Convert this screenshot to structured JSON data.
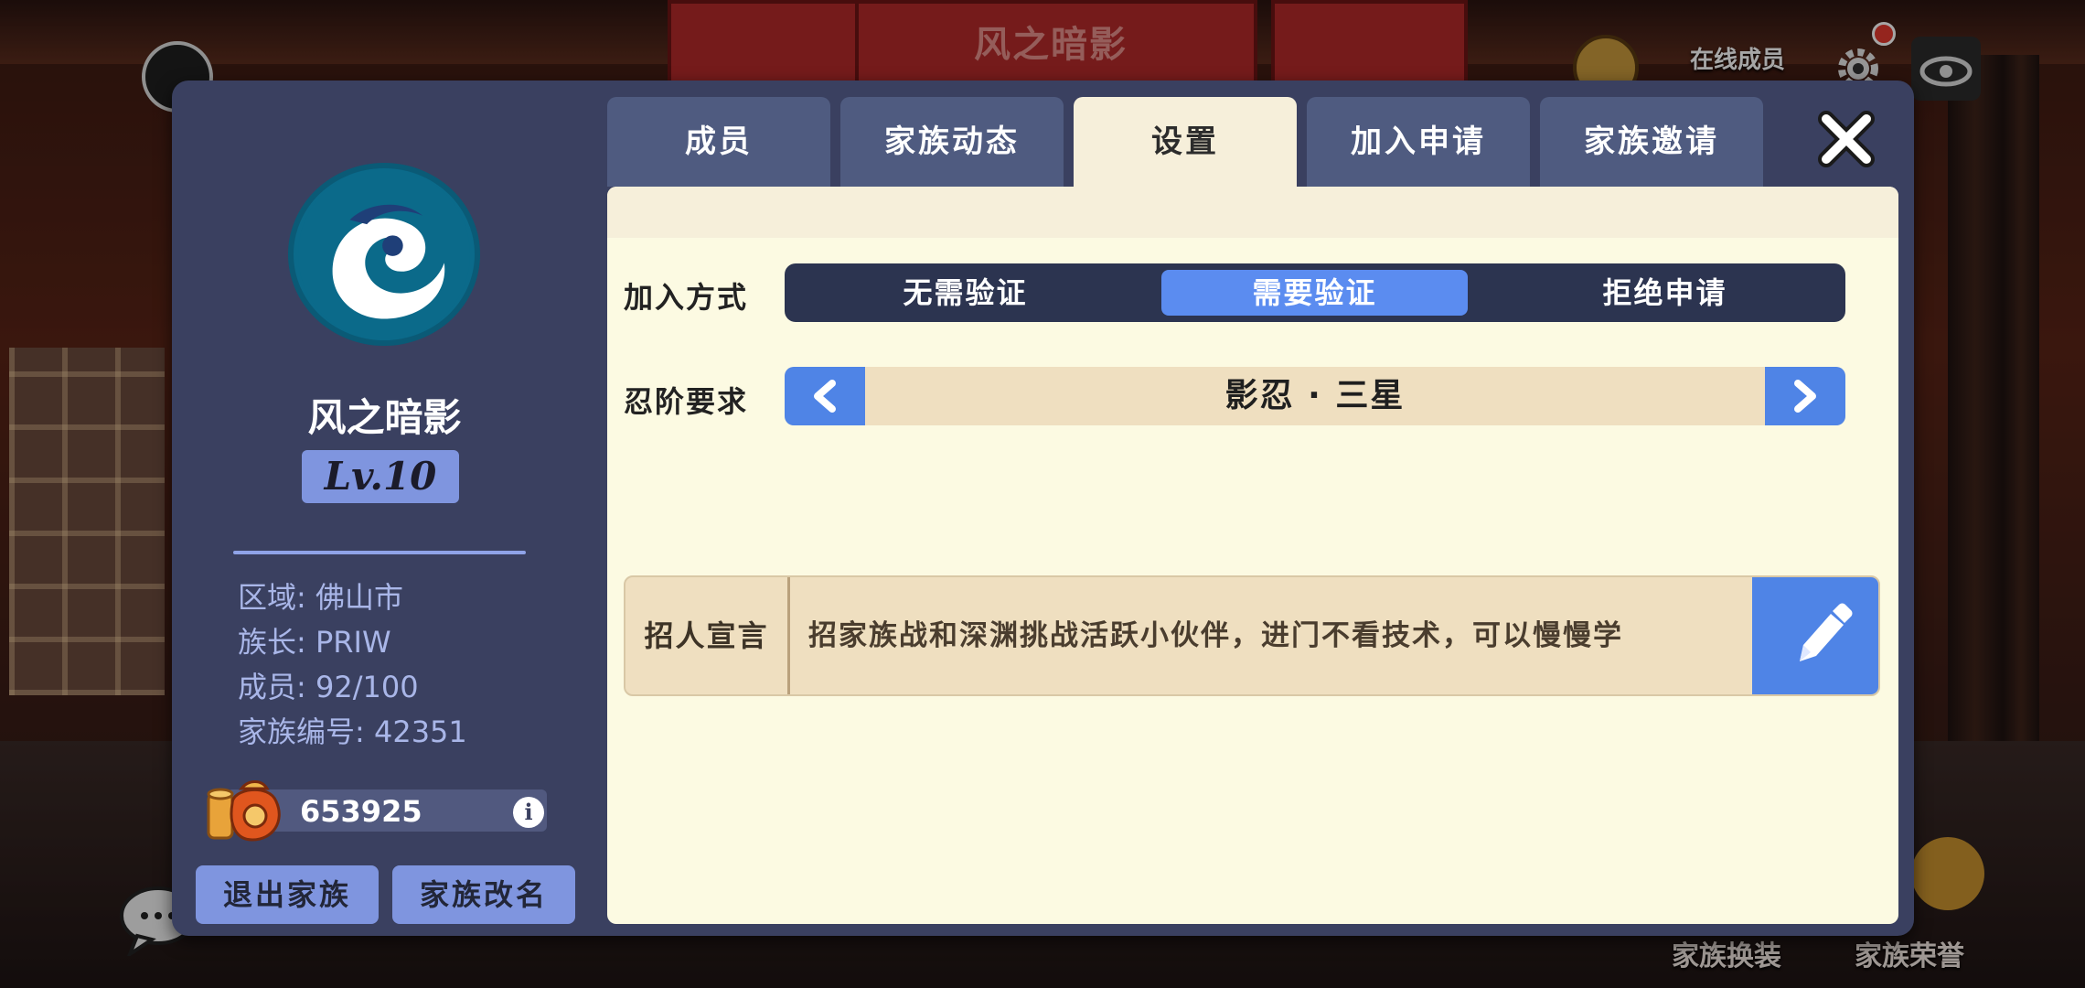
{
  "background": {
    "banner_title": "风之暗影",
    "online_label": "在线成员",
    "bottom_labels": [
      "家族换装",
      "家族荣誉"
    ]
  },
  "family": {
    "name": "风之暗影",
    "level": "Lv.10",
    "info": [
      {
        "label": "区域: ",
        "value": "佛山市"
      },
      {
        "label": "族长: ",
        "value": "PRIW"
      },
      {
        "label": "成员: ",
        "value": "92/100"
      },
      {
        "label": "家族编号: ",
        "value": "42351"
      }
    ],
    "funds": "653925",
    "info_icon": "i",
    "buttons": {
      "quit": "退出家族",
      "rename": "家族改名"
    }
  },
  "tabs": [
    {
      "label": "成员",
      "active": false
    },
    {
      "label": "家族动态",
      "active": false
    },
    {
      "label": "设置",
      "active": true
    },
    {
      "label": "加入申请",
      "active": false
    },
    {
      "label": "家族邀请",
      "active": false
    }
  ],
  "settings": {
    "join_method": {
      "label": "加入方式",
      "options": [
        "无需验证",
        "需要验证",
        "拒绝申请"
      ],
      "selected": "需要验证"
    },
    "rank_requirement": {
      "label": "忍阶要求",
      "value": "影忍 · 三星",
      "prev_icon": "<",
      "next_icon": ">"
    },
    "recruit": {
      "label": "招人宣言",
      "text": "招家族战和深渊挑战活跃小伙伴，进门不看技术，可以慢慢学"
    }
  },
  "colors": {
    "panel": "#3a4060",
    "accent": "#5b8cf0",
    "content_bg": "#fcfae2",
    "level_badge": "#7f95df"
  },
  "icons": [
    "close-icon",
    "chevron-left-icon",
    "chevron-right-icon",
    "pencil-icon",
    "coin-bag-icon",
    "info-icon",
    "family-emblem-icon",
    "gear-icon",
    "eye-icon",
    "chat-icon",
    "trophy-icon"
  ]
}
